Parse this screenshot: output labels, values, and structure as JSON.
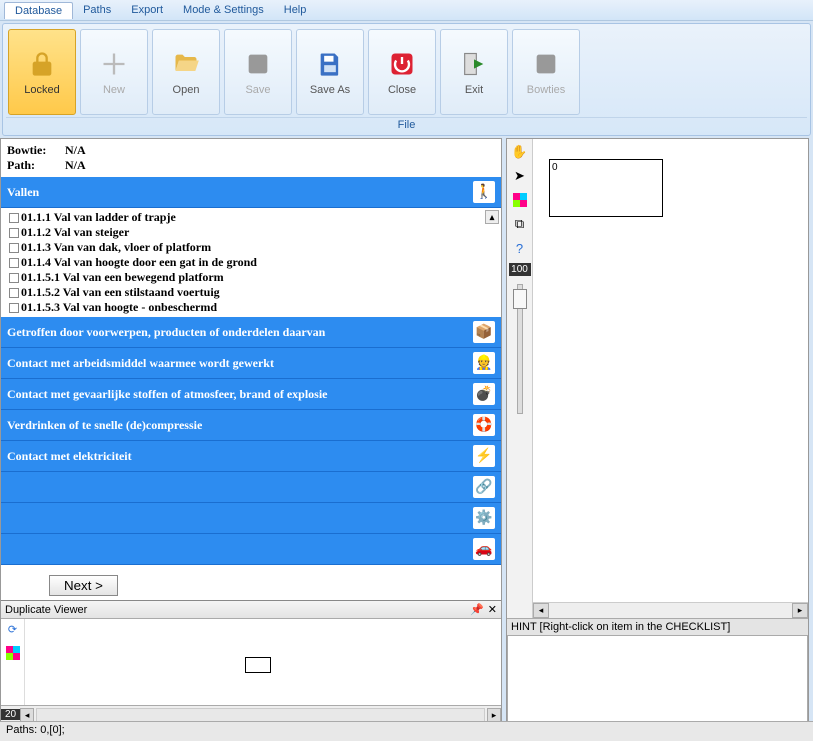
{
  "menu": {
    "items": [
      "Database",
      "Paths",
      "Export",
      "Mode & Settings",
      "Help"
    ],
    "active": 0
  },
  "ribbon": {
    "group_label": "File",
    "buttons": [
      {
        "label": "Locked",
        "active": true
      },
      {
        "label": "New",
        "disabled": true
      },
      {
        "label": "Open"
      },
      {
        "label": "Save",
        "disabled": true
      },
      {
        "label": "Save As"
      },
      {
        "label": "Close"
      },
      {
        "label": "Exit"
      },
      {
        "label": "Bowties",
        "disabled": true
      }
    ]
  },
  "info": {
    "bowtie_label": "Bowtie:",
    "bowtie_value": "N/A",
    "path_label": "Path:",
    "path_value": "N/A"
  },
  "categories": [
    {
      "title": "Vallen",
      "icon": "🚶",
      "expanded": true,
      "items": [
        "01.1.1 Val van ladder of trapje",
        "01.1.2 Val van steiger",
        "01.1.3 Van van dak, vloer of platform",
        "01.1.4 Val van hoogte door een gat in de grond",
        "01.1.5.1 Val van een bewegend platform",
        "01.1.5.2 Val van een stilstaand voertuig",
        "01.1.5.3 Val van hoogte - onbeschermd"
      ]
    },
    {
      "title": "Getroffen door voorwerpen, producten of onderdelen daarvan",
      "icon": "📦"
    },
    {
      "title": "Contact met arbeidsmiddel waarmee wordt gewerkt",
      "icon": "👷"
    },
    {
      "title": "Contact met gevaarlijke stoffen of atmosfeer, brand of explosie",
      "icon": "💣"
    },
    {
      "title": "Verdrinken of te snelle (de)compressie",
      "icon": "🛟"
    },
    {
      "title": "Contact met elektriciteit",
      "icon": "⚡"
    },
    {
      "title": "",
      "icon": "🔗"
    },
    {
      "title": "",
      "icon": "⚙️"
    },
    {
      "title": "",
      "icon": "🚗"
    }
  ],
  "next_label": "Next >",
  "dup": {
    "title": "Duplicate Viewer",
    "footer_num": "20"
  },
  "canvas": {
    "node_label": "0",
    "zoom": "100"
  },
  "hint": "HINT [Right-click on item in the CHECKLIST]",
  "status": "Paths: 0,[0];"
}
